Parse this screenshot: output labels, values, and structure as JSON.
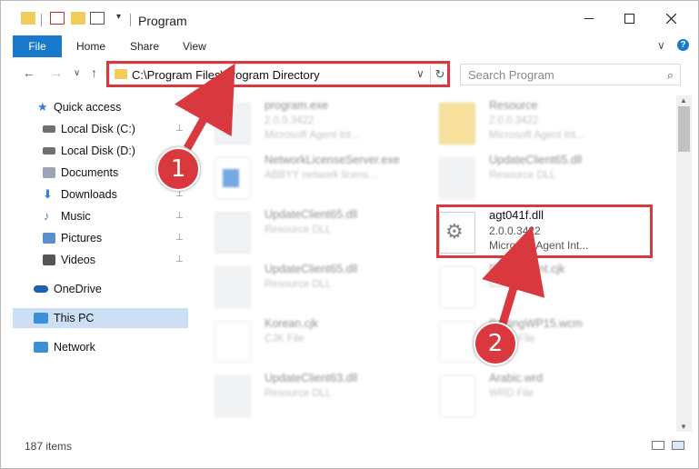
{
  "window": {
    "title": "Program",
    "minimize_icon": "minimize-icon",
    "maximize_icon": "maximize-icon",
    "close_icon": "close-icon"
  },
  "ribbon": {
    "tabs": [
      {
        "label": "File"
      },
      {
        "label": "Home"
      },
      {
        "label": "Share"
      },
      {
        "label": "View"
      }
    ],
    "expand_glyph": "∨",
    "help_glyph": "?"
  },
  "address": {
    "path": "C:\\Program Files\\Program Directory",
    "back_glyph": "←",
    "forward_glyph": "→",
    "recent_glyph": "∨",
    "up_glyph": "↑",
    "drop_glyph": "∨",
    "refresh_glyph": "↻"
  },
  "search": {
    "placeholder": "Search Program",
    "icon_glyph": "⌕"
  },
  "sidebar": {
    "items": [
      {
        "label": "Quick access",
        "icon": "star-icon",
        "color": "#2f7fd6",
        "pinned": false
      },
      {
        "label": "Local Disk (C:)",
        "icon": "drive-icon",
        "color": "#6f6f6f",
        "pinned": true
      },
      {
        "label": "Local Disk (D:)",
        "icon": "drive-icon",
        "color": "#6f6f6f",
        "pinned": false
      },
      {
        "label": "Documents",
        "icon": "documents-icon",
        "color": "#9aa6b8",
        "pinned": true
      },
      {
        "label": "Downloads",
        "icon": "download-icon",
        "color": "#2f7fd6",
        "pinned": true
      },
      {
        "label": "Music",
        "icon": "music-icon",
        "color": "#2f7fd6",
        "pinned": true
      },
      {
        "label": "Pictures",
        "icon": "pictures-icon",
        "color": "#5a8fcc",
        "pinned": true
      },
      {
        "label": "Videos",
        "icon": "videos-icon",
        "color": "#555555",
        "pinned": true
      },
      {
        "label": "OneDrive",
        "icon": "cloud-icon",
        "color": "#1f5fb4",
        "pinned": false
      },
      {
        "label": "This PC",
        "icon": "computer-icon",
        "color": "#3c8fd9",
        "pinned": false,
        "selected": true
      },
      {
        "label": "Network",
        "icon": "network-icon",
        "color": "#3c8fd9",
        "pinned": false
      }
    ],
    "pin_glyph": "📌"
  },
  "files": [
    {
      "name": "program.exe",
      "line2": "2.0.0.3422",
      "line3": "Microsoft Agent Int...",
      "icon": "exe-icon",
      "highlighted": false
    },
    {
      "name": "Resource",
      "line2": "2.0.0.3422",
      "line3": "Microsoft Agent Int...",
      "icon": "folder-icon",
      "highlighted": false
    },
    {
      "name": "NetworkLicenseServer.exe",
      "line2": "ABBYY network licens...",
      "line3": "",
      "icon": "exe-icon",
      "highlighted": false
    },
    {
      "name": "UpdateClient65.dll",
      "line2": "Resource DLL",
      "line3": "",
      "icon": "dll-icon",
      "highlighted": false
    },
    {
      "name": "UpdateClient65.dll",
      "line2": "Resource DLL",
      "line3": "",
      "icon": "dll-icon",
      "highlighted": false
    },
    {
      "name": "agt041f.dll",
      "line2": "2.0.0.3422",
      "line3": "Microsoft Agent Int...",
      "icon": "dll-gear-icon",
      "highlighted": true
    },
    {
      "name": "UpdateClient65.dll",
      "line2": "Resource DLL",
      "line3": "",
      "icon": "dll-icon",
      "highlighted": false
    },
    {
      "name": "DefaultFont.cjk",
      "line2": "CJK File",
      "line3": "",
      "icon": "file-icon",
      "highlighted": false
    },
    {
      "name": "Korean.cjk",
      "line2": "CJK File",
      "line3": "",
      "icon": "file-icon",
      "highlighted": false
    },
    {
      "name": "SortingWP15.wcm",
      "line2": "WCM File",
      "line3": "",
      "icon": "file-icon",
      "highlighted": false
    },
    {
      "name": "UpdateClient63.dll",
      "line2": "Resource DLL",
      "line3": "",
      "icon": "dll-icon",
      "highlighted": false
    },
    {
      "name": "Arabic.wrd",
      "line2": "WRD File",
      "line3": "",
      "icon": "file-icon",
      "highlighted": false
    }
  ],
  "status": {
    "item_count": "187 items"
  },
  "annotations": {
    "callout_1": "1",
    "callout_2": "2",
    "highlight_color": "#d8383e"
  }
}
